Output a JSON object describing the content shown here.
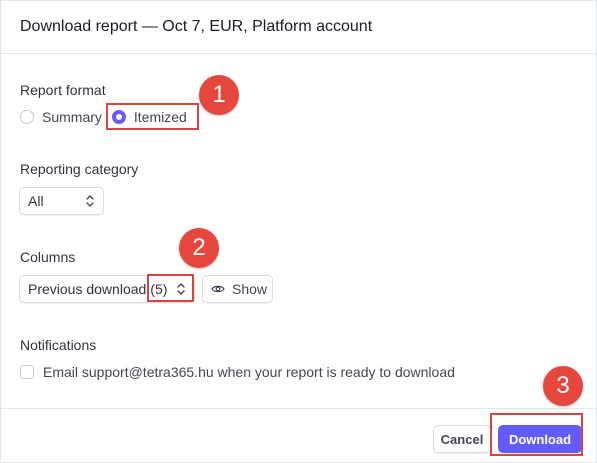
{
  "header": {
    "title": "Download report — Oct 7, EUR, Platform account"
  },
  "report_format": {
    "label": "Report format",
    "options": [
      "Summary",
      "Itemized"
    ],
    "selected": "Itemized"
  },
  "reporting_category": {
    "label": "Reporting category",
    "value": "All"
  },
  "columns": {
    "label": "Columns",
    "select_value": "Previous download",
    "count": "(5)",
    "show_label": "Show"
  },
  "notifications": {
    "label": "Notifications",
    "email_text": "Email support@tetra365.hu when your report is ready to download",
    "checked": false
  },
  "footer": {
    "cancel_label": "Cancel",
    "download_label": "Download"
  },
  "annotations": [
    "1",
    "2",
    "3"
  ],
  "colors": {
    "accent": "#635bff",
    "annotation": "#e5473d"
  }
}
